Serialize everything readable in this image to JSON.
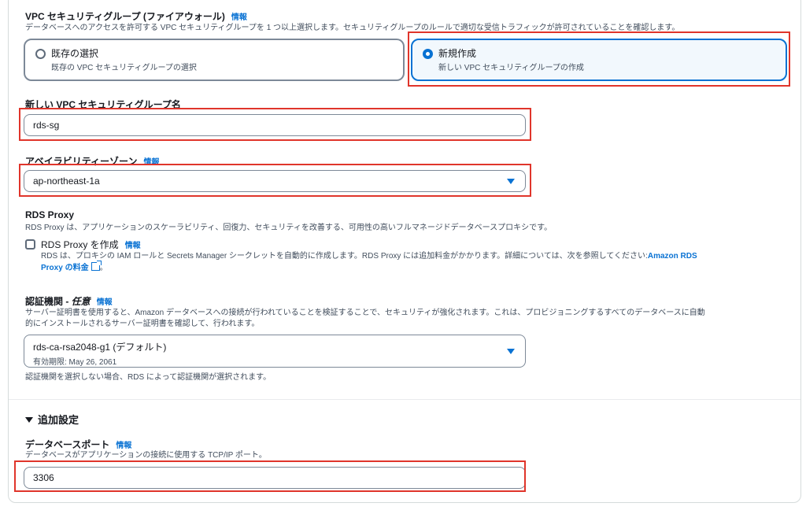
{
  "vpc_sg": {
    "label": "VPC セキュリティグループ (ファイアウォール)",
    "info": "情報",
    "description": "データベースへのアクセスを許可する VPC セキュリティグループを 1 つ以上選択します。セキュリティグループのルールで適切な受信トラフィックが許可されていることを確認します。",
    "options": [
      {
        "title": "既存の選択",
        "subtitle": "既存の VPC セキュリティグループの選択",
        "selected": false
      },
      {
        "title": "新規作成",
        "subtitle": "新しい VPC セキュリティグループの作成",
        "selected": true
      }
    ]
  },
  "new_sg_name": {
    "label": "新しい VPC セキュリティグループ名",
    "value": "rds-sg"
  },
  "az": {
    "label": "アベイラビリティーゾーン",
    "info": "情報",
    "value": "ap-northeast-1a"
  },
  "rds_proxy": {
    "heading": "RDS Proxy",
    "description": "RDS Proxy は、アプリケーションのスケーラビリティ、回復力、セキュリティを改善する、可用性の高いフルマネージドデータベースプロキシです。",
    "checkbox_label": "RDS Proxy を作成",
    "info": "情報",
    "detail_line1": "RDS は、プロキシの IAM ロールと Secrets Manager シークレットを自動的に作成します。RDS Proxy には追加料金がかかります。詳細については、次を参照してください:",
    "link_part1": "Amazon RDS",
    "link_part2": "Proxy の料金",
    "suffix": "。"
  },
  "ca": {
    "label": "認証機関 - ",
    "label_optional": "任意",
    "info": "情報",
    "description_line1": "サーバー証明書を使用すると、Amazon データベースへの接続が行われていることを検証することで、セキュリティが強化されます。これは、プロビジョニングするすべてのデータベースに自動",
    "description_line2": "的にインストールされるサーバー証明書を確認して、行われます。",
    "value": "rds-ca-rsa2048-g1 (デフォルト)",
    "expiry": "有効期限: May 26, 2061",
    "footer": "認証機関を選択しない場合、RDS によって認証機関が選択されます。"
  },
  "additional": {
    "heading": "追加設定"
  },
  "db_port": {
    "label": "データベースポート",
    "info": "情報",
    "description": "データベースがアプリケーションの接続に使用する TCP/IP ポート。",
    "value": "3306"
  },
  "colors": {
    "accent": "#0972d3",
    "highlight": "#e0352b",
    "text": "#16191f",
    "muted": "#414d5c"
  }
}
